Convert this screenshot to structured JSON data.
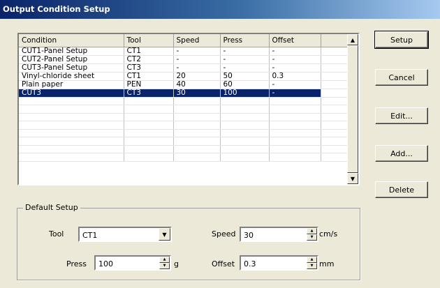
{
  "window": {
    "title": "Output Condition Setup"
  },
  "table": {
    "columns": [
      "Condition",
      "Tool",
      "Speed",
      "Press",
      "Offset"
    ],
    "rows": [
      [
        "CUT1-Panel Setup",
        "CT1",
        "-",
        "-",
        "-"
      ],
      [
        "CUT2-Panel Setup",
        "CT2",
        "-",
        "-",
        "-"
      ],
      [
        "CUT3-Panel Setup",
        "CT3",
        "-",
        "-",
        "-"
      ],
      [
        "Vinyl-chloride sheet",
        "CT1",
        "20",
        "50",
        "0.3"
      ],
      [
        "Plain paper",
        "PEN",
        "40",
        "60",
        "-"
      ],
      [
        "CUT3",
        "CT3",
        "30",
        "100",
        "-"
      ]
    ],
    "selected_row": 5
  },
  "buttons": {
    "setup": "Setup",
    "cancel": "Cancel",
    "edit": "Edit...",
    "add": "Add...",
    "delete": "Delete"
  },
  "default_setup": {
    "legend": "Default Setup",
    "tool_label": "Tool",
    "tool_value": "CT1",
    "speed_label": "Speed",
    "speed_value": "30",
    "speed_unit": "cm/s",
    "press_label": "Press",
    "press_value": "100",
    "press_unit": "g",
    "offset_label": "Offset",
    "offset_value": "0.3",
    "offset_unit": "mm"
  }
}
